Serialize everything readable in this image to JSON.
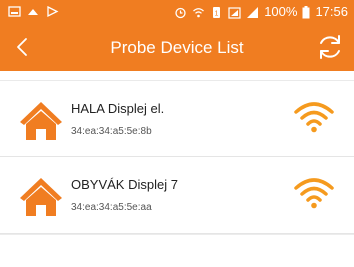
{
  "status_bar": {
    "battery": "100%",
    "time": "17:56"
  },
  "app_bar": {
    "title": "Probe Device List",
    "back_icon": "back-chevron-icon",
    "refresh_icon": "refresh-icon"
  },
  "devices": [
    {
      "name": "HALA Displej el.",
      "mac": "34:ea:34:a5:5e:8b",
      "icon": "house-icon",
      "signal_icon": "wifi-signal-icon"
    },
    {
      "name": "OBYVÁK Displej 7",
      "mac": "34:ea:34:a5:5e:aa",
      "icon": "house-icon",
      "signal_icon": "wifi-signal-icon"
    }
  ],
  "colors": {
    "accent": "#f07d21",
    "background": "#ffffff"
  }
}
